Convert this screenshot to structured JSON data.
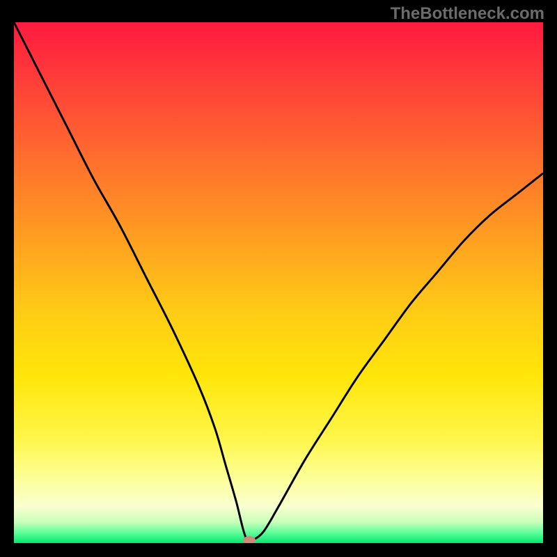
{
  "watermark": "TheBottleneck.com",
  "chart_data": {
    "type": "line",
    "title": "",
    "xlabel": "",
    "ylabel": "",
    "xlim": [
      0,
      100
    ],
    "ylim": [
      0,
      100
    ],
    "series": [
      {
        "name": "curve",
        "x": [
          0,
          5,
          10,
          15,
          20,
          25,
          30,
          35,
          38,
          40,
          42,
          43.5,
          44.5,
          47,
          50,
          55,
          60,
          65,
          70,
          75,
          80,
          85,
          90,
          95,
          100
        ],
        "y": [
          100,
          90,
          80,
          70,
          61,
          51,
          41,
          30,
          22,
          15,
          8,
          2,
          0.5,
          2,
          7,
          16,
          24,
          32,
          39,
          46,
          52,
          58,
          63,
          67,
          71
        ]
      }
    ],
    "marker": {
      "x": 44.5,
      "y": 0.6
    },
    "colors": {
      "curve": "#000000",
      "marker": "#d08a7a",
      "gradient_top": "#ff1a3f",
      "gradient_bottom": "#00e86e",
      "frame": "#000000"
    }
  }
}
